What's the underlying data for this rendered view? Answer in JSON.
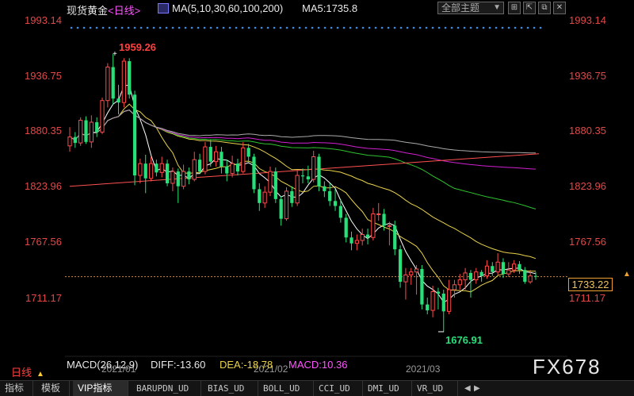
{
  "header": {
    "instrument": "现货黄金",
    "period": "<日线>",
    "ma_label": "MA(5,10,30,60,100,200)",
    "ma5_label": "MA5:1735.8",
    "theme_select": "全部主题"
  },
  "toolbar_icons": [
    "grid-icon",
    "expand-icon",
    "restore-icon",
    "close-icon"
  ],
  "axis_ticks": [
    "1993.14",
    "1936.75",
    "1880.35",
    "1823.96",
    "1767.56",
    "1711.17"
  ],
  "current_price": "1733.22",
  "annotations": {
    "high": "1959.26",
    "low": "1676.91"
  },
  "macd": {
    "title": "MACD(26,12,9)",
    "diff": "DIFF:-13.60",
    "dea": "DEA:-18.78",
    "macd": "MACD:10.36"
  },
  "date_labels": [
    "2021/01",
    "2021/02",
    "2021/03"
  ],
  "period_button": "日线",
  "brand": "FX678",
  "bottom_tabs": [
    "指标",
    "模板",
    "VIP指标",
    "BARUPDN_UD",
    "BIAS_UD",
    "BOLL_UD",
    "CCI_UD",
    "DMI_UD",
    "VR_UD"
  ],
  "colors": {
    "bg": "#000000",
    "up_candle": "#ff4a4a",
    "down_candle": "#27e07a",
    "ma5": "#ffffff",
    "ma10": "#e8d24a",
    "ma30": "#e8d24a",
    "ma60": "#2ec22e",
    "ma100": "#d020d0",
    "ma200": "#aaaaaa",
    "flat": "#ff5050",
    "axis": "#e04848",
    "dot_row": "#3a8ee8"
  },
  "chart_data": {
    "type": "candlestick",
    "series": [
      {
        "name": "MA5"
      },
      {
        "name": "MA10"
      },
      {
        "name": "MA30"
      },
      {
        "name": "MA60"
      },
      {
        "name": "MA100"
      },
      {
        "name": "MA200"
      }
    ],
    "candles": [
      [
        1866,
        1875,
        1885,
        1860
      ],
      [
        1875,
        1869,
        1880,
        1864
      ],
      [
        1869,
        1892,
        1895,
        1866
      ],
      [
        1892,
        1870,
        1896,
        1868
      ],
      [
        1870,
        1890,
        1897,
        1864
      ],
      [
        1890,
        1880,
        1895,
        1875
      ],
      [
        1880,
        1912,
        1915,
        1878
      ],
      [
        1912,
        1946,
        1950,
        1905
      ],
      [
        1946,
        1914,
        1959.26,
        1908
      ],
      [
        1914,
        1910,
        1928,
        1898
      ],
      [
        1910,
        1952,
        1955,
        1905
      ],
      [
        1952,
        1918,
        1955,
        1914
      ],
      [
        1918,
        1836,
        1922,
        1826
      ],
      [
        1836,
        1848,
        1853,
        1828
      ],
      [
        1848,
        1833,
        1857,
        1818
      ],
      [
        1833,
        1848,
        1855,
        1830
      ],
      [
        1848,
        1839,
        1852,
        1835
      ],
      [
        1839,
        1848,
        1855,
        1834
      ],
      [
        1848,
        1828,
        1852,
        1825
      ],
      [
        1828,
        1840,
        1844,
        1820
      ],
      [
        1840,
        1825,
        1843,
        1808
      ],
      [
        1825,
        1840,
        1847,
        1822
      ],
      [
        1840,
        1832,
        1844,
        1827
      ],
      [
        1832,
        1852,
        1860,
        1830
      ],
      [
        1852,
        1840,
        1858,
        1838
      ],
      [
        1840,
        1865,
        1870,
        1837
      ],
      [
        1865,
        1850,
        1872,
        1845
      ],
      [
        1850,
        1860,
        1866,
        1845
      ],
      [
        1860,
        1845,
        1865,
        1838
      ],
      [
        1845,
        1838,
        1852,
        1830
      ],
      [
        1838,
        1848,
        1856,
        1834
      ],
      [
        1848,
        1840,
        1853,
        1836
      ],
      [
        1840,
        1864,
        1870,
        1838
      ],
      [
        1864,
        1855,
        1868,
        1848
      ],
      [
        1855,
        1822,
        1858,
        1818
      ],
      [
        1822,
        1808,
        1828,
        1800
      ],
      [
        1808,
        1819,
        1825,
        1803
      ],
      [
        1819,
        1840,
        1845,
        1815
      ],
      [
        1840,
        1812,
        1844,
        1808
      ],
      [
        1812,
        1792,
        1815,
        1785
      ],
      [
        1792,
        1820,
        1824,
        1790
      ],
      [
        1820,
        1808,
        1825,
        1804
      ],
      [
        1808,
        1836,
        1841,
        1805
      ],
      [
        1836,
        1835,
        1843,
        1828
      ],
      [
        1835,
        1832,
        1846,
        1828
      ],
      [
        1832,
        1855,
        1861,
        1829
      ],
      [
        1855,
        1825,
        1858,
        1820
      ],
      [
        1825,
        1820,
        1830,
        1814
      ],
      [
        1820,
        1810,
        1828,
        1805
      ],
      [
        1810,
        1805,
        1822,
        1800
      ],
      [
        1805,
        1793,
        1812,
        1788
      ],
      [
        1793,
        1773,
        1797,
        1768
      ],
      [
        1773,
        1767,
        1779,
        1760
      ],
      [
        1767,
        1770,
        1776,
        1760
      ],
      [
        1770,
        1776,
        1782,
        1765
      ],
      [
        1776,
        1773,
        1782,
        1766
      ],
      [
        1773,
        1797,
        1803,
        1770
      ],
      [
        1797,
        1797,
        1808,
        1790
      ],
      [
        1797,
        1785,
        1802,
        1780
      ],
      [
        1785,
        1785,
        1789,
        1765
      ],
      [
        1785,
        1761,
        1790,
        1755
      ],
      [
        1761,
        1728,
        1765,
        1722
      ],
      [
        1728,
        1735,
        1742,
        1710
      ],
      [
        1735,
        1738,
        1742,
        1725
      ],
      [
        1738,
        1741,
        1745,
        1715
      ],
      [
        1741,
        1705,
        1745,
        1700
      ],
      [
        1705,
        1699,
        1712,
        1695
      ],
      [
        1699,
        1718,
        1724,
        1692
      ],
      [
        1718,
        1716,
        1722,
        1700
      ],
      [
        1716,
        1698,
        1720,
        1676.91
      ],
      [
        1698,
        1720,
        1730,
        1695
      ],
      [
        1720,
        1725,
        1730,
        1712
      ],
      [
        1725,
        1730,
        1736,
        1720
      ],
      [
        1730,
        1737,
        1742,
        1720
      ],
      [
        1737,
        1730,
        1740,
        1712
      ],
      [
        1730,
        1738,
        1742,
        1726
      ],
      [
        1738,
        1734,
        1740,
        1728
      ],
      [
        1734,
        1744,
        1750,
        1731
      ],
      [
        1744,
        1738,
        1748,
        1734
      ],
      [
        1738,
        1748,
        1757,
        1735
      ],
      [
        1748,
        1736,
        1752,
        1732
      ],
      [
        1736,
        1740,
        1748,
        1733
      ],
      [
        1740,
        1746,
        1750,
        1737
      ],
      [
        1746,
        1740,
        1749,
        1736
      ],
      [
        1740,
        1728,
        1743,
        1726
      ],
      [
        1728,
        1734,
        1740,
        1726
      ],
      [
        1734,
        1733.22,
        1738,
        1730
      ]
    ],
    "y_range": [
      1660,
      2000
    ]
  }
}
